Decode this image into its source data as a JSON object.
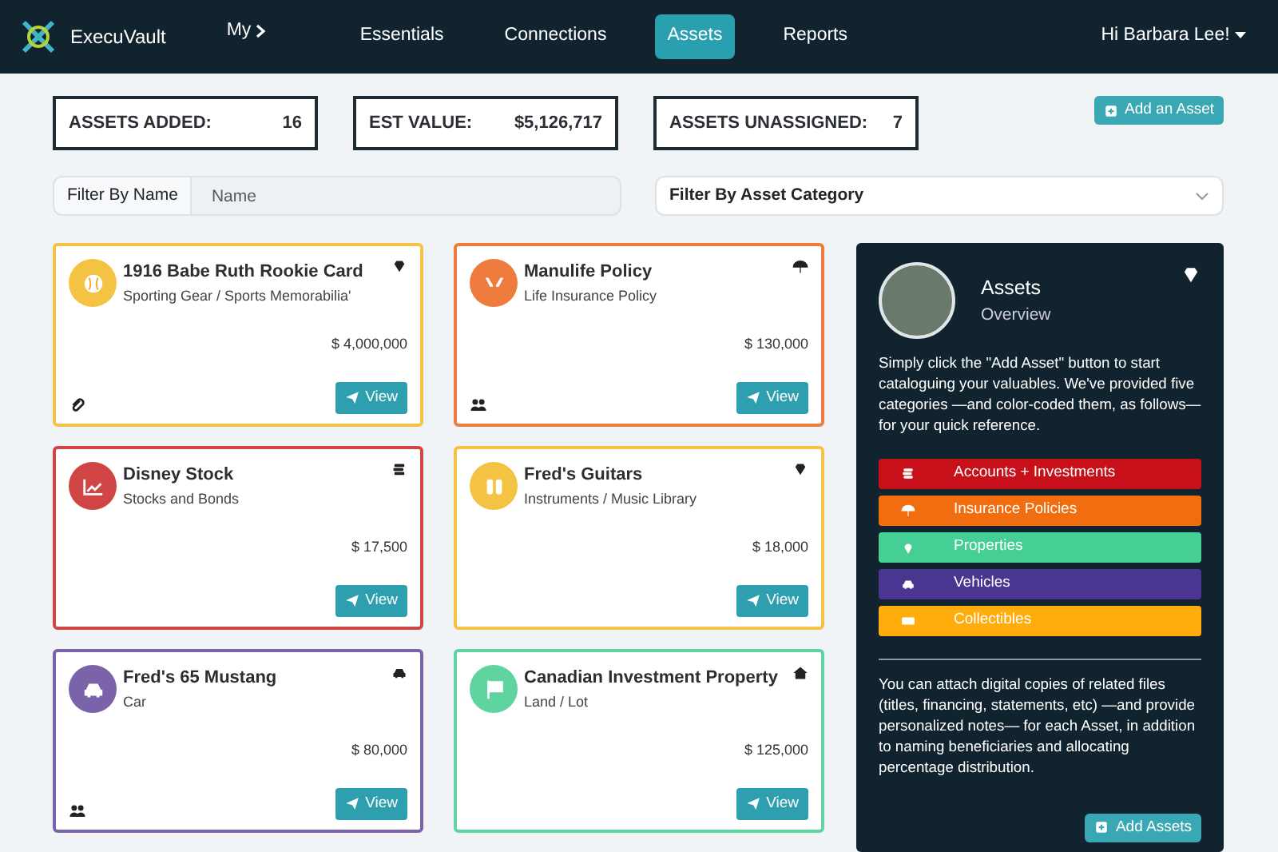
{
  "navbar": {
    "brand": "ExecuVault",
    "items": [
      {
        "label": "My",
        "kind": "menu",
        "selected": false
      },
      {
        "label": "Essentials",
        "kind": "link",
        "selected": false
      },
      {
        "label": "Connections",
        "kind": "link",
        "selected": false
      },
      {
        "label": "Assets",
        "kind": "link",
        "selected": true
      },
      {
        "label": "Reports",
        "kind": "link",
        "selected": false
      }
    ],
    "user": "Hi Barbara Lee!"
  },
  "stats": [
    {
      "label": "ASSETS ADDED:",
      "value": "16"
    },
    {
      "label": "EST VALUE:",
      "value": "$5,126,717"
    },
    {
      "label": "ASSETS UNASSIGNED:",
      "value": "7"
    }
  ],
  "add_button": "Add an Asset",
  "filters": {
    "name_label": "Filter By Name",
    "name_placeholder": "Name",
    "category": "Filter By Asset Category"
  },
  "assets": [
    {
      "title": "1916 Babe Ruth Rookie Card",
      "subtitle": "Sporting Gear / Sports Memorabilia'",
      "value": "$ 4,000,000",
      "color": "#f5c344",
      "button": "View"
    },
    {
      "title": "Manulife Policy",
      "subtitle": "Life Insurance Policy",
      "value": "$ 130,000",
      "color": "#f07b3f",
      "button": "View"
    },
    {
      "title": "Disney Stock",
      "subtitle": "Stocks and Bonds",
      "value": "$ 17,500",
      "color": "#d24545",
      "button": "View"
    },
    {
      "title": "Fred's Guitars",
      "subtitle": "Instruments / Music Library",
      "value": "$ 18,000",
      "color": "#f5c344",
      "button": "View"
    },
    {
      "title": "Fred's 65 Mustang",
      "subtitle": "Car",
      "value": "$ 80,000",
      "color": "#7a63a8",
      "button": "View"
    },
    {
      "title": "Canadian Investment Property",
      "subtitle": "Land / Lot",
      "value": "$ 125,000",
      "color": "#5fd3a0",
      "button": "View"
    }
  ],
  "overview": {
    "title": "Assets",
    "subtitle": "Overview",
    "intro": "Simply click the \"Add Asset\" button to start cataloguing your valuables. We've provided five categories —and color-coded them, as follows— for your quick reference.",
    "categories": [
      {
        "label": "Accounts + Investments",
        "color": "#c8101a"
      },
      {
        "label": "Insurance Policies",
        "color": "#f26d0f"
      },
      {
        "label": "Properties",
        "color": "#45cf95"
      },
      {
        "label": "Vehicles",
        "color": "#4a3591"
      },
      {
        "label": "Collectibles",
        "color": "#ffad0d"
      }
    ],
    "note": "You can attach digital copies of related files (titles, financing, statements, etc) —and provide personalized notes— for each Asset, in addition to naming beneficiaries and allocating percentage distribution.",
    "button": "Add Assets"
  }
}
